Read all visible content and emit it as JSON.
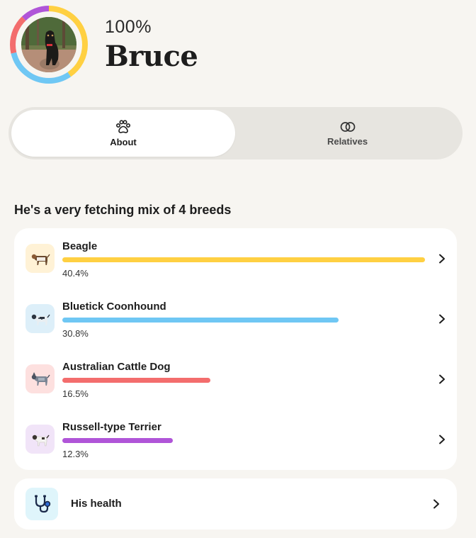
{
  "header": {
    "percent": "100%",
    "name": "Bruce"
  },
  "tabs": [
    {
      "label": "About",
      "icon": "paw-icon",
      "active": true
    },
    {
      "label": "Relatives",
      "icon": "linked-rings-icon",
      "active": false
    }
  ],
  "breeds_section": {
    "title": "He's a very fetching mix of 4 breeds",
    "breeds": [
      {
        "name": "Beagle",
        "percent_label": "40.4%",
        "percent": 40.4,
        "color": "#ffd042",
        "badge_color": "#fff2d6",
        "icon": "beagle-icon"
      },
      {
        "name": "Bluetick Coonhound",
        "percent_label": "30.8%",
        "percent": 30.8,
        "color": "#6fc7f4",
        "badge_color": "#ddeff9",
        "icon": "bluetick-coonhound-icon"
      },
      {
        "name": "Australian Cattle Dog",
        "percent_label": "16.5%",
        "percent": 16.5,
        "color": "#f36d6d",
        "badge_color": "#fde0df",
        "icon": "australian-cattle-dog-icon"
      },
      {
        "name": "Russell-type Terrier",
        "percent_label": "12.3%",
        "percent": 12.3,
        "color": "#b055d8",
        "badge_color": "#f1e4f8",
        "icon": "russell-terrier-icon"
      }
    ]
  },
  "health": {
    "label": "His health",
    "icon": "stethoscope-icon",
    "badge_color": "#dff5fb"
  }
}
